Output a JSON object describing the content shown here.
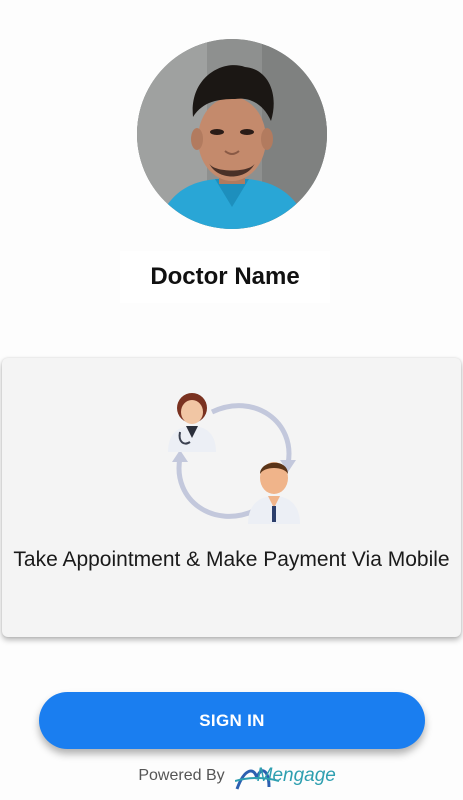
{
  "profile": {
    "doctor_name": "Doctor Name"
  },
  "card": {
    "illustration_icon": "doctor-patient-cycle-icon",
    "text": "Take Appointment & Make Payment Via Mobile"
  },
  "actions": {
    "signin_label": "SIGN IN"
  },
  "footer": {
    "powered_by": "Powered By",
    "brand": "Mengage"
  },
  "colors": {
    "accent": "#1a7ef0",
    "card_bg": "#f4f4f4",
    "brand_teal": "#2e9fb0"
  }
}
